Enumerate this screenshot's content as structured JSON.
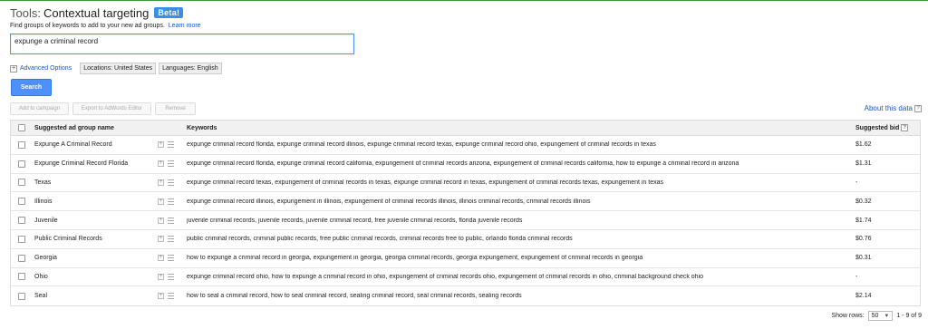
{
  "header": {
    "prefix": "Tools:",
    "title": "Contextual targeting",
    "badge": "Beta!",
    "subtitle": "Find groups of keywords to add to your new ad groups.",
    "learn_more": "Learn more"
  },
  "search": {
    "value": "expunge a criminal record"
  },
  "options": {
    "advanced": "Advanced Options",
    "location": "Locations: United States",
    "language": "Languages: English"
  },
  "search_button": "Search",
  "actions": {
    "add": "Add to campaign",
    "export": "Export to AdWords Editor",
    "remove": "Remove"
  },
  "about_data": "About this data",
  "table": {
    "headers": {
      "name": "Suggested ad group name",
      "keywords": "Keywords",
      "bid": "Suggested bid"
    },
    "rows": [
      {
        "name": "Expunge A Criminal Record",
        "keywords": "expunge criminal record florida, expunge criminal record illinois, expunge criminal record texas, expunge criminal record ohio, expungement of criminal records in texas",
        "bid": "$1.62"
      },
      {
        "name": "Expunge Criminal Record Florida",
        "keywords": "expunge criminal record florida, expunge criminal record california, expungement of criminal records arizona, expungement of criminal records california, how to expunge a criminal record in arizona",
        "bid": "$1.31"
      },
      {
        "name": "Texas",
        "keywords": "expunge criminal record texas, expungement of criminal records in texas, expunge criminal record in texas, expungement of criminal records texas, expungement in texas",
        "bid": "-"
      },
      {
        "name": "Illinois",
        "keywords": "expunge criminal record illinois, expungement in illinois, expungement of criminal records illinois, illinois criminal records, criminal records illinois",
        "bid": "$0.32"
      },
      {
        "name": "Juvenile",
        "keywords": "juvenile criminal records, juvenile records, juvenile criminal record, free juvenile criminal records, florida juvenile records",
        "bid": "$1.74"
      },
      {
        "name": "Public Criminal Records",
        "keywords": "public criminal records, criminal public records, free public criminal records, criminal records free to public, orlando florida criminal records",
        "bid": "$0.76"
      },
      {
        "name": "Georgia",
        "keywords": "how to expunge a criminal record in georgia, expungement in georgia, georgia criminal records, georgia expungement, expungement of criminal records in georgia",
        "bid": "$0.31"
      },
      {
        "name": "Ohio",
        "keywords": "expunge criminal record ohio, how to expunge a criminal record in ohio, expungement of criminal records ohio, expungement of criminal records in ohio, criminal background check ohio",
        "bid": "-"
      },
      {
        "name": "Seal",
        "keywords": "how to seal a criminal record, how to seal criminal record, sealing criminal record, seal criminal records, sealing records",
        "bid": "$2.14"
      }
    ]
  },
  "footer": {
    "show_rows_label": "Show rows:",
    "rows_value": "50",
    "range": "1 - 9 of 9"
  },
  "colors": {
    "accent": "#4d90fe",
    "badge": "#3b8ee6",
    "link": "#1a55c8"
  }
}
